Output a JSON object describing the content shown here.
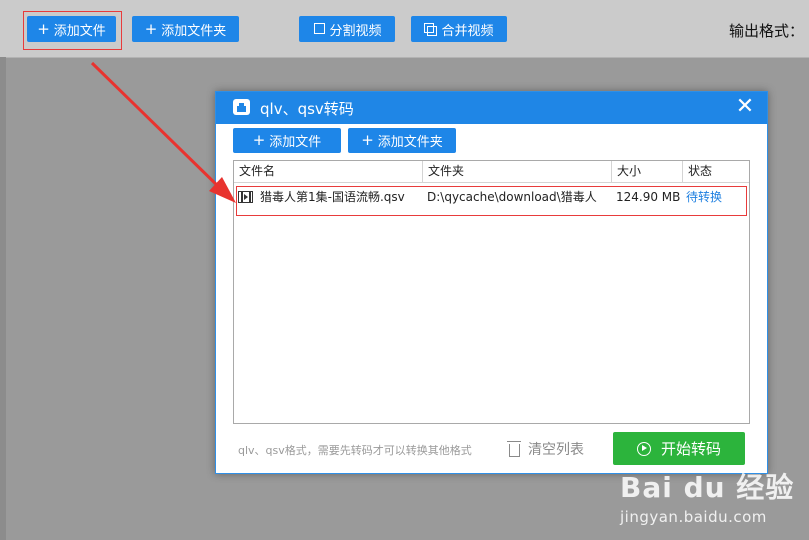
{
  "toolbar": {
    "add_file": "添加文件",
    "add_folder": "添加文件夹",
    "split_video": "分割视频",
    "merge_video": "合并视频",
    "output_format_label": "输出格式："
  },
  "dialog": {
    "title": "qlv、qsv转码",
    "close": "✕",
    "add_file": "添加文件",
    "add_folder": "添加文件夹",
    "columns": [
      "文件名",
      "文件夹",
      "大小",
      "状态"
    ],
    "rows": [
      {
        "name": "猎毒人第1集-国语流畅.qsv",
        "folder": "D:\\qycache\\download\\猎毒人",
        "size": "124.90 MB",
        "status": "待转换"
      }
    ],
    "hint": "qlv、qsv格式，需要先转码才可以转换其他格式",
    "clear_list": "清空列表",
    "start": "开始转码"
  },
  "watermark": {
    "main": "Bai du 经验",
    "sub": "jingyan.baidu.com"
  },
  "colors": {
    "accent": "#1e86e8",
    "start": "#2cb43c",
    "highlight": "#e83b3b",
    "status_link": "#1e7fe0"
  }
}
